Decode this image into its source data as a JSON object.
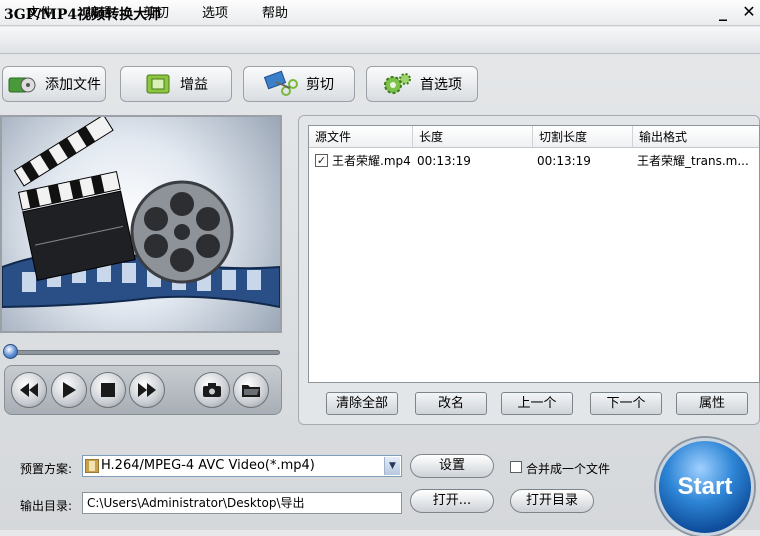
{
  "window": {
    "title": "3GP/MP4视频转换大师",
    "minimize": "_",
    "close": "✕"
  },
  "menu": [
    "文件",
    "编辑",
    "剪切",
    "选项",
    "帮助"
  ],
  "toolbar": {
    "add_file": "添加文件",
    "gain": "增益",
    "cut": "剪切",
    "preferences": "首选项"
  },
  "file_list": {
    "columns": [
      "源文件",
      "长度",
      "切割长度",
      "输出格式"
    ],
    "rows": [
      {
        "checked": true,
        "source": "王者荣耀.mp4",
        "length": "00:13:19",
        "cut_length": "00:13:19",
        "output": "王者荣耀_trans.m..."
      }
    ],
    "buttons": {
      "clear_all": "清除全部",
      "rename": "改名",
      "move_up": "上一个",
      "move_down": "下一个",
      "properties": "属性"
    }
  },
  "settings": {
    "preset_label": "预置方案:",
    "preset_value": "H.264/MPEG-4 AVC Video(*.mp4)",
    "settings_button": "设置",
    "merge_label": "合并成一个文件",
    "merge_checked": false,
    "output_label": "输出目录:",
    "output_path": "C:\\Users\\Administrator\\Desktop\\导出",
    "open_button": "打开...",
    "open_dir_button": "打开目录"
  },
  "start_button": "Start",
  "player": {
    "progress": 0
  },
  "colors": {
    "start_blue": "#2f86d6",
    "list_bg": "#ffffff",
    "accent_border": "#7f9db9"
  }
}
